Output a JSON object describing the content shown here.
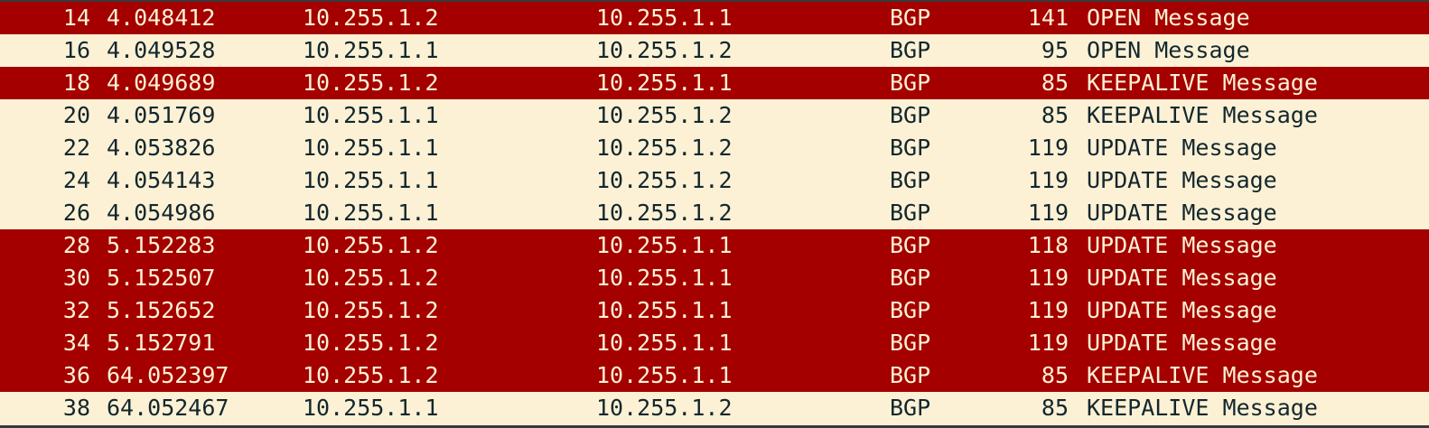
{
  "colors": {
    "direction_a_bg": "#a40000",
    "direction_a_fg": "#fdf1d5",
    "direction_b_bg": "#fdf1d5",
    "direction_b_fg": "#12272e"
  },
  "packets": [
    {
      "no": "14",
      "time": "4.048412",
      "source": "10.255.1.2",
      "destination": "10.255.1.1",
      "protocol": "BGP",
      "length": "141",
      "info": "OPEN Message",
      "direction": "a"
    },
    {
      "no": "16",
      "time": "4.049528",
      "source": "10.255.1.1",
      "destination": "10.255.1.2",
      "protocol": "BGP",
      "length": "95",
      "info": "OPEN Message",
      "direction": "b"
    },
    {
      "no": "18",
      "time": "4.049689",
      "source": "10.255.1.2",
      "destination": "10.255.1.1",
      "protocol": "BGP",
      "length": "85",
      "info": "KEEPALIVE Message",
      "direction": "a"
    },
    {
      "no": "20",
      "time": "4.051769",
      "source": "10.255.1.1",
      "destination": "10.255.1.2",
      "protocol": "BGP",
      "length": "85",
      "info": "KEEPALIVE Message",
      "direction": "b"
    },
    {
      "no": "22",
      "time": "4.053826",
      "source": "10.255.1.1",
      "destination": "10.255.1.2",
      "protocol": "BGP",
      "length": "119",
      "info": "UPDATE Message",
      "direction": "b"
    },
    {
      "no": "24",
      "time": "4.054143",
      "source": "10.255.1.1",
      "destination": "10.255.1.2",
      "protocol": "BGP",
      "length": "119",
      "info": "UPDATE Message",
      "direction": "b"
    },
    {
      "no": "26",
      "time": "4.054986",
      "source": "10.255.1.1",
      "destination": "10.255.1.2",
      "protocol": "BGP",
      "length": "119",
      "info": "UPDATE Message",
      "direction": "b"
    },
    {
      "no": "28",
      "time": "5.152283",
      "source": "10.255.1.2",
      "destination": "10.255.1.1",
      "protocol": "BGP",
      "length": "118",
      "info": "UPDATE Message",
      "direction": "a"
    },
    {
      "no": "30",
      "time": "5.152507",
      "source": "10.255.1.2",
      "destination": "10.255.1.1",
      "protocol": "BGP",
      "length": "119",
      "info": "UPDATE Message",
      "direction": "a"
    },
    {
      "no": "32",
      "time": "5.152652",
      "source": "10.255.1.2",
      "destination": "10.255.1.1",
      "protocol": "BGP",
      "length": "119",
      "info": "UPDATE Message",
      "direction": "a"
    },
    {
      "no": "34",
      "time": "5.152791",
      "source": "10.255.1.2",
      "destination": "10.255.1.1",
      "protocol": "BGP",
      "length": "119",
      "info": "UPDATE Message",
      "direction": "a"
    },
    {
      "no": "36",
      "time": "64.052397",
      "source": "10.255.1.2",
      "destination": "10.255.1.1",
      "protocol": "BGP",
      "length": "85",
      "info": "KEEPALIVE Message",
      "direction": "a"
    },
    {
      "no": "38",
      "time": "64.052467",
      "source": "10.255.1.1",
      "destination": "10.255.1.2",
      "protocol": "BGP",
      "length": "85",
      "info": "KEEPALIVE Message",
      "direction": "b"
    }
  ]
}
